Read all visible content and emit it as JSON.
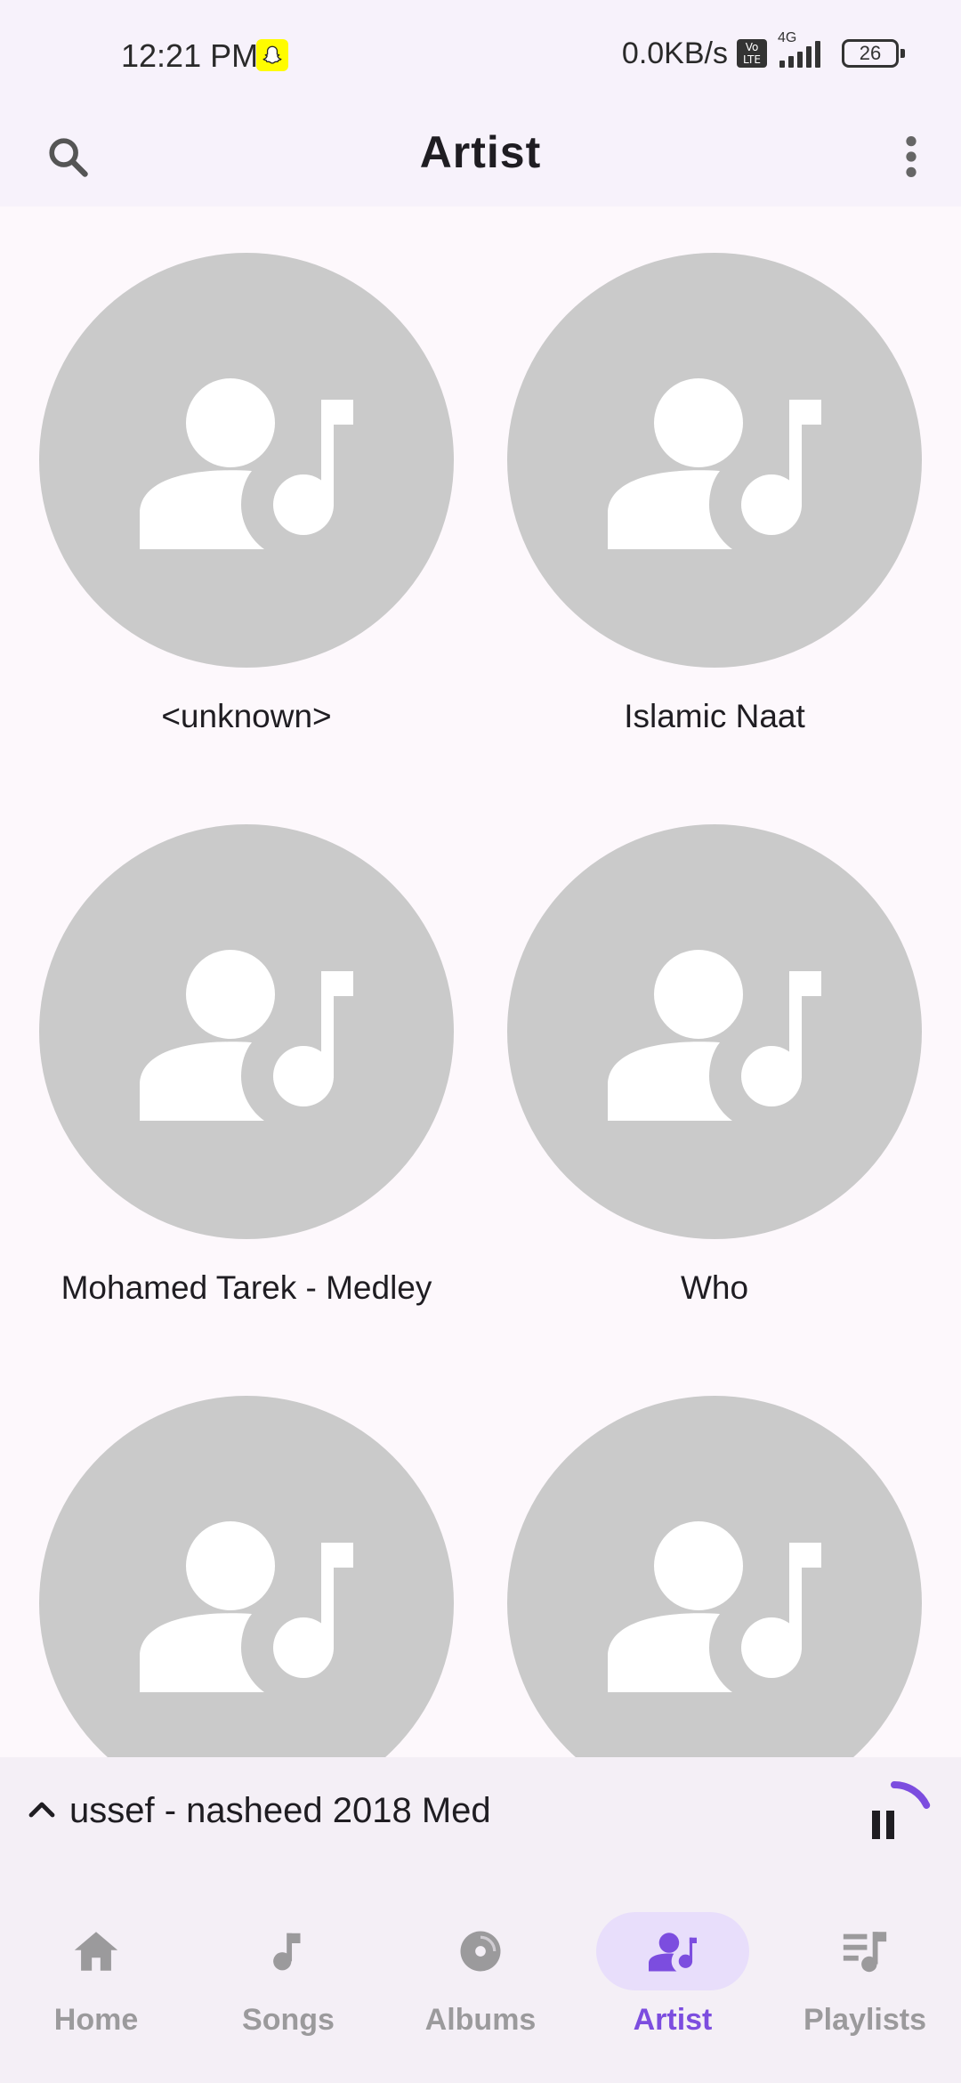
{
  "status_bar": {
    "time": "12:21 PM",
    "net_speed": "0.0KB/s",
    "volte_top": "Vo",
    "volte_bottom": "LTE",
    "network_type": "4G",
    "battery": "26",
    "icons": [
      "snapchat-notification-icon",
      "volte-icon",
      "signal-icon",
      "battery-icon"
    ]
  },
  "app_bar": {
    "title": "Artist",
    "icons": [
      "search-icon",
      "more-vert-icon"
    ]
  },
  "artists": [
    {
      "name": "<unknown>"
    },
    {
      "name": "Islamic Naat"
    },
    {
      "name": "Mohamed Tarek - Medley"
    },
    {
      "name": "Who"
    },
    {
      "name": ""
    },
    {
      "name": ""
    }
  ],
  "artist_icon": "artist-placeholder-icon",
  "mini_player": {
    "title": "ussef - nasheed 2018 Med",
    "progress": 0.18,
    "icons": [
      "chevron-up-icon",
      "pause-icon"
    ]
  },
  "bottom_nav": {
    "items": [
      {
        "label": "Home",
        "icon": "home-icon",
        "active": false
      },
      {
        "label": "Songs",
        "icon": "music-note-icon",
        "active": false
      },
      {
        "label": "Albums",
        "icon": "album-icon",
        "active": false
      },
      {
        "label": "Artist",
        "icon": "artist-icon",
        "active": true
      },
      {
        "label": "Playlists",
        "icon": "playlist-icon",
        "active": false
      }
    ]
  },
  "colors": {
    "accent": "#7c4ddf",
    "accent_container": "#e8defb",
    "avatar_bg": "#cacaca",
    "surface": "#f7f2fb",
    "background": "#fdf8fc",
    "inactive": "#9b9a9c"
  }
}
